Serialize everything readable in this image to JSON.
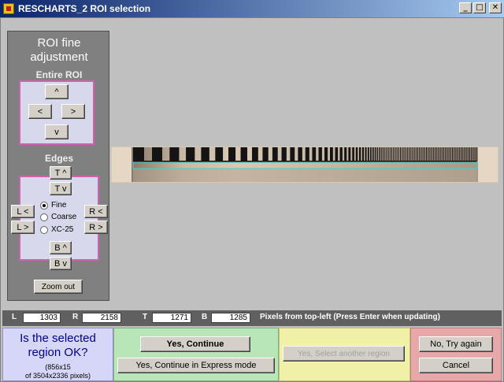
{
  "window": {
    "title": "RESCHARTS_2 ROI selection",
    "buttons": [
      "_",
      "□",
      "✕"
    ]
  },
  "panel": {
    "title_line1": "ROI fine",
    "title_line2": "adjustment",
    "entire_roi_label": "Entire ROI",
    "entire_buttons": {
      "up": "^",
      "left": "<",
      "right": ">",
      "down": "v"
    },
    "edges_label": "Edges",
    "edge_buttons": {
      "top_up": "T ^",
      "top_down": "T v",
      "left_left": "L <",
      "left_right": "L >",
      "right_left": "R <",
      "right_right": "R >",
      "bottom_up": "B ^",
      "bottom_down": "B v"
    },
    "step_options": [
      "Fine",
      "Coarse",
      "XC-25"
    ],
    "step_selected": "Fine",
    "zoom_out_label": "Zoom out"
  },
  "coords": {
    "L_label": "L",
    "L_value": "1303",
    "R_label": "R",
    "R_value": "2158",
    "T_label": "T",
    "T_value": "1271",
    "B_label": "B",
    "B_value": "1285",
    "note": "Pixels from top-left  (Press Enter when updating)"
  },
  "question": {
    "title_line1": "Is the selected",
    "title_line2": "region OK?",
    "size_line1": "(856x15",
    "size_line2": "of 3504x2336 pixels)"
  },
  "actions": {
    "yes_continue": "Yes, Continue",
    "yes_express": "Yes, Continue in Express mode",
    "yes_select_another": "Yes, Select another region",
    "no_try_again": "No, Try again",
    "cancel": "Cancel"
  },
  "colors": {
    "roi_box": "#40d0d0",
    "panel_border": "#d060b0"
  }
}
